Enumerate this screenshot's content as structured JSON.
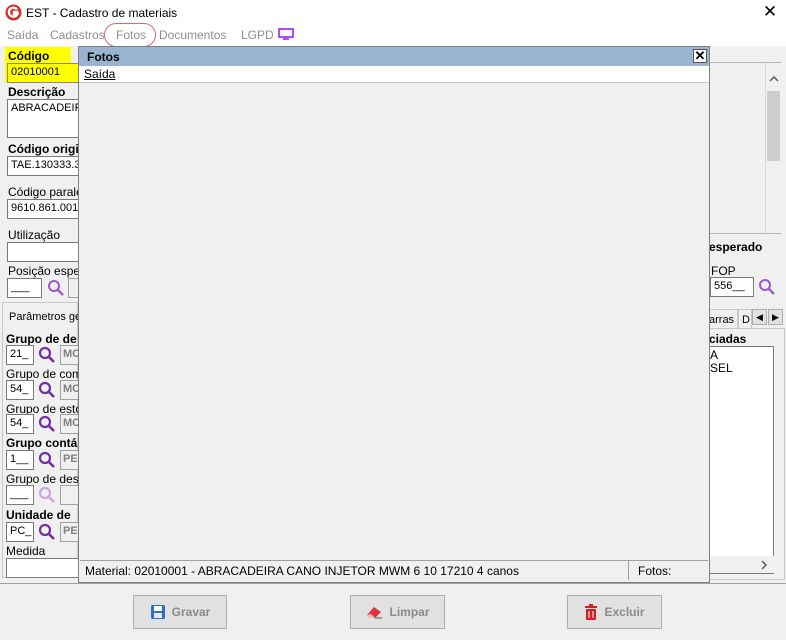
{
  "window": {
    "title": "EST - Cadastro de materiais",
    "close_glyph": "✕"
  },
  "menu": {
    "items": [
      "Saída",
      "Cadastros",
      "Fotos",
      "Documentos",
      "LGPD"
    ],
    "highlighted": "Fotos"
  },
  "form": {
    "codigo": {
      "label": "Código",
      "value": "02010001"
    },
    "descricao": {
      "label": "Descrição",
      "value": "ABRACADEIR"
    },
    "codigo_original": {
      "label": "Código origin",
      "value": "TAE.130333.3"
    },
    "codigo_paralelo": {
      "label": "Código paralel",
      "value": "9610.861.001"
    },
    "utilizacao": {
      "label": "Utilização",
      "value": ""
    },
    "posicao": {
      "label": "Posição espec",
      "value": "___"
    },
    "parametros_tab": "Parâmetros ge",
    "grupo_de": {
      "label": "Grupo de de",
      "code": "21_",
      "desc": "MC"
    },
    "grupo_comp": {
      "label": "Grupo de comp",
      "code": "54_",
      "desc": "MC"
    },
    "grupo_estoq": {
      "label": "Grupo de estoc",
      "code": "54_",
      "desc": "MC"
    },
    "grupo_contab": {
      "label": "Grupo contá",
      "code": "1__",
      "desc": "PE"
    },
    "grupo_desp": {
      "label": "Grupo de desp",
      "code": "___",
      "desc": ""
    },
    "unidade": {
      "label": "Unidade de",
      "code": "PC_",
      "desc": "PE"
    },
    "medida": {
      "label": "Medida",
      "value": ""
    }
  },
  "right": {
    "esperado_label": "esperado",
    "fop_label": "FOP",
    "fop_value": "556__",
    "tabs": [
      "arras",
      "D"
    ],
    "associadas_label": "ciadas",
    "associadas_items": [
      "A",
      "SEL"
    ]
  },
  "modal": {
    "title": "Fotos",
    "close_glyph": "✕",
    "menu_item": "Saída",
    "status_material": "Material: 02010001 - ABRACADEIRA CANO INJETOR MWM 6 10 17210 4 canos",
    "status_fotos": "Fotos:"
  },
  "buttons": {
    "gravar": "Gravar",
    "limpar": "Limpar",
    "excluir": "Excluir"
  },
  "colors": {
    "codigo_highlight": "#ffff00",
    "modal_header": "#99b4d1",
    "search_icon": "#7030a0",
    "menu_ring": "#e06666"
  }
}
